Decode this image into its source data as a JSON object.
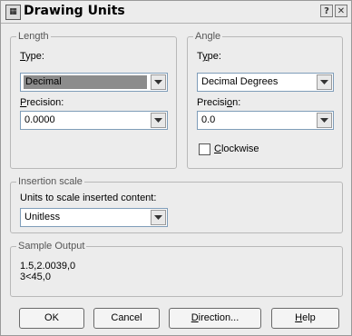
{
  "window": {
    "title": "Drawing Units",
    "help_glyph": "?",
    "close_glyph": "✕"
  },
  "length": {
    "group_label": "Length",
    "type_label_prefix": "",
    "type_label_ul": "T",
    "type_label_rest": "ype:",
    "type_value": "Decimal",
    "precision_label_ul": "P",
    "precision_label_rest": "recision:",
    "precision_value": "0.0000"
  },
  "angle": {
    "group_label": "Angle",
    "type_label_pre": "T",
    "type_label_ul": "y",
    "type_label_rest": "pe:",
    "type_value": "Decimal Degrees",
    "precision_label_pre": "Precisi",
    "precision_label_ul": "o",
    "precision_label_rest": "n:",
    "precision_value": "0.0",
    "clockwise_ul": "C",
    "clockwise_rest": "lockwise",
    "clockwise_checked": false
  },
  "insertion": {
    "group_label": "Insertion scale",
    "units_label": "Units to scale inserted content:",
    "units_value": "Unitless"
  },
  "sample": {
    "group_label": "Sample Output",
    "line1": "1.5,2.0039,0",
    "line2": "3<45,0"
  },
  "buttons": {
    "ok": "OK",
    "cancel": "Cancel",
    "direction_ul": "D",
    "direction_rest": "irection...",
    "help_ul": "H",
    "help_rest": "elp"
  }
}
